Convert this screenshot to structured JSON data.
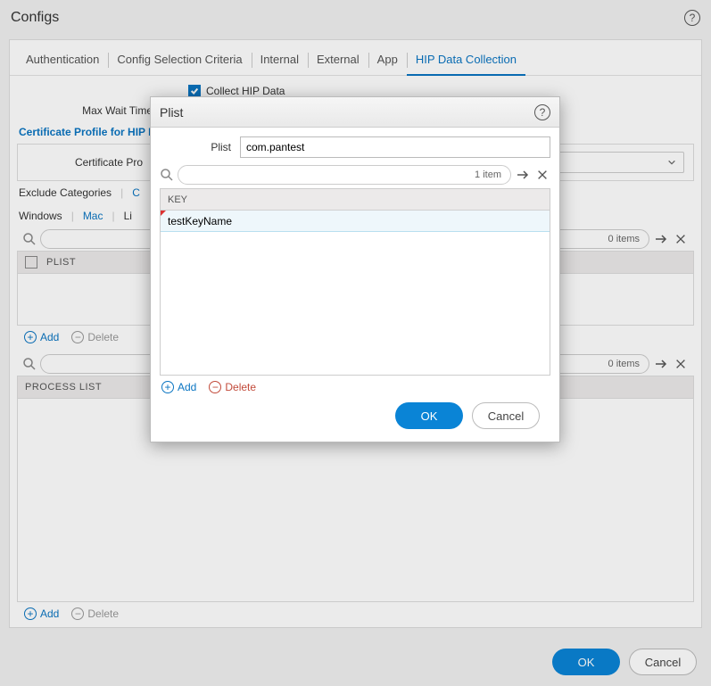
{
  "window": {
    "title": "Configs"
  },
  "tabs": {
    "items": [
      "Authentication",
      "Config Selection Criteria",
      "Internal",
      "External",
      "App",
      "HIP Data Collection"
    ],
    "active": 5
  },
  "collect_hip_label": "Collect HIP Data",
  "max_wait_label": "Max Wait Time (se",
  "cert_profile_heading": "Certificate Profile for HIP P",
  "cert_profile_label": "Certificate Pro",
  "exclude_categories_label": "Exclude Categories",
  "exclude_c_fragment": "C",
  "os_tabs": {
    "items": [
      "Windows",
      "Mac",
      "Li"
    ],
    "active": 1
  },
  "plist_table": {
    "header": "PLIST",
    "count_label": "0 items"
  },
  "process_table": {
    "header": "PROCESS LIST",
    "count_label": "0 items"
  },
  "actions": {
    "add": "Add",
    "delete": "Delete"
  },
  "buttons": {
    "ok": "OK",
    "cancel": "Cancel"
  },
  "modal": {
    "title": "Plist",
    "field_label": "Plist",
    "field_value": "com.pantest",
    "count_label": "1 item",
    "grid_header": "KEY",
    "rows": [
      "testKeyName"
    ]
  }
}
